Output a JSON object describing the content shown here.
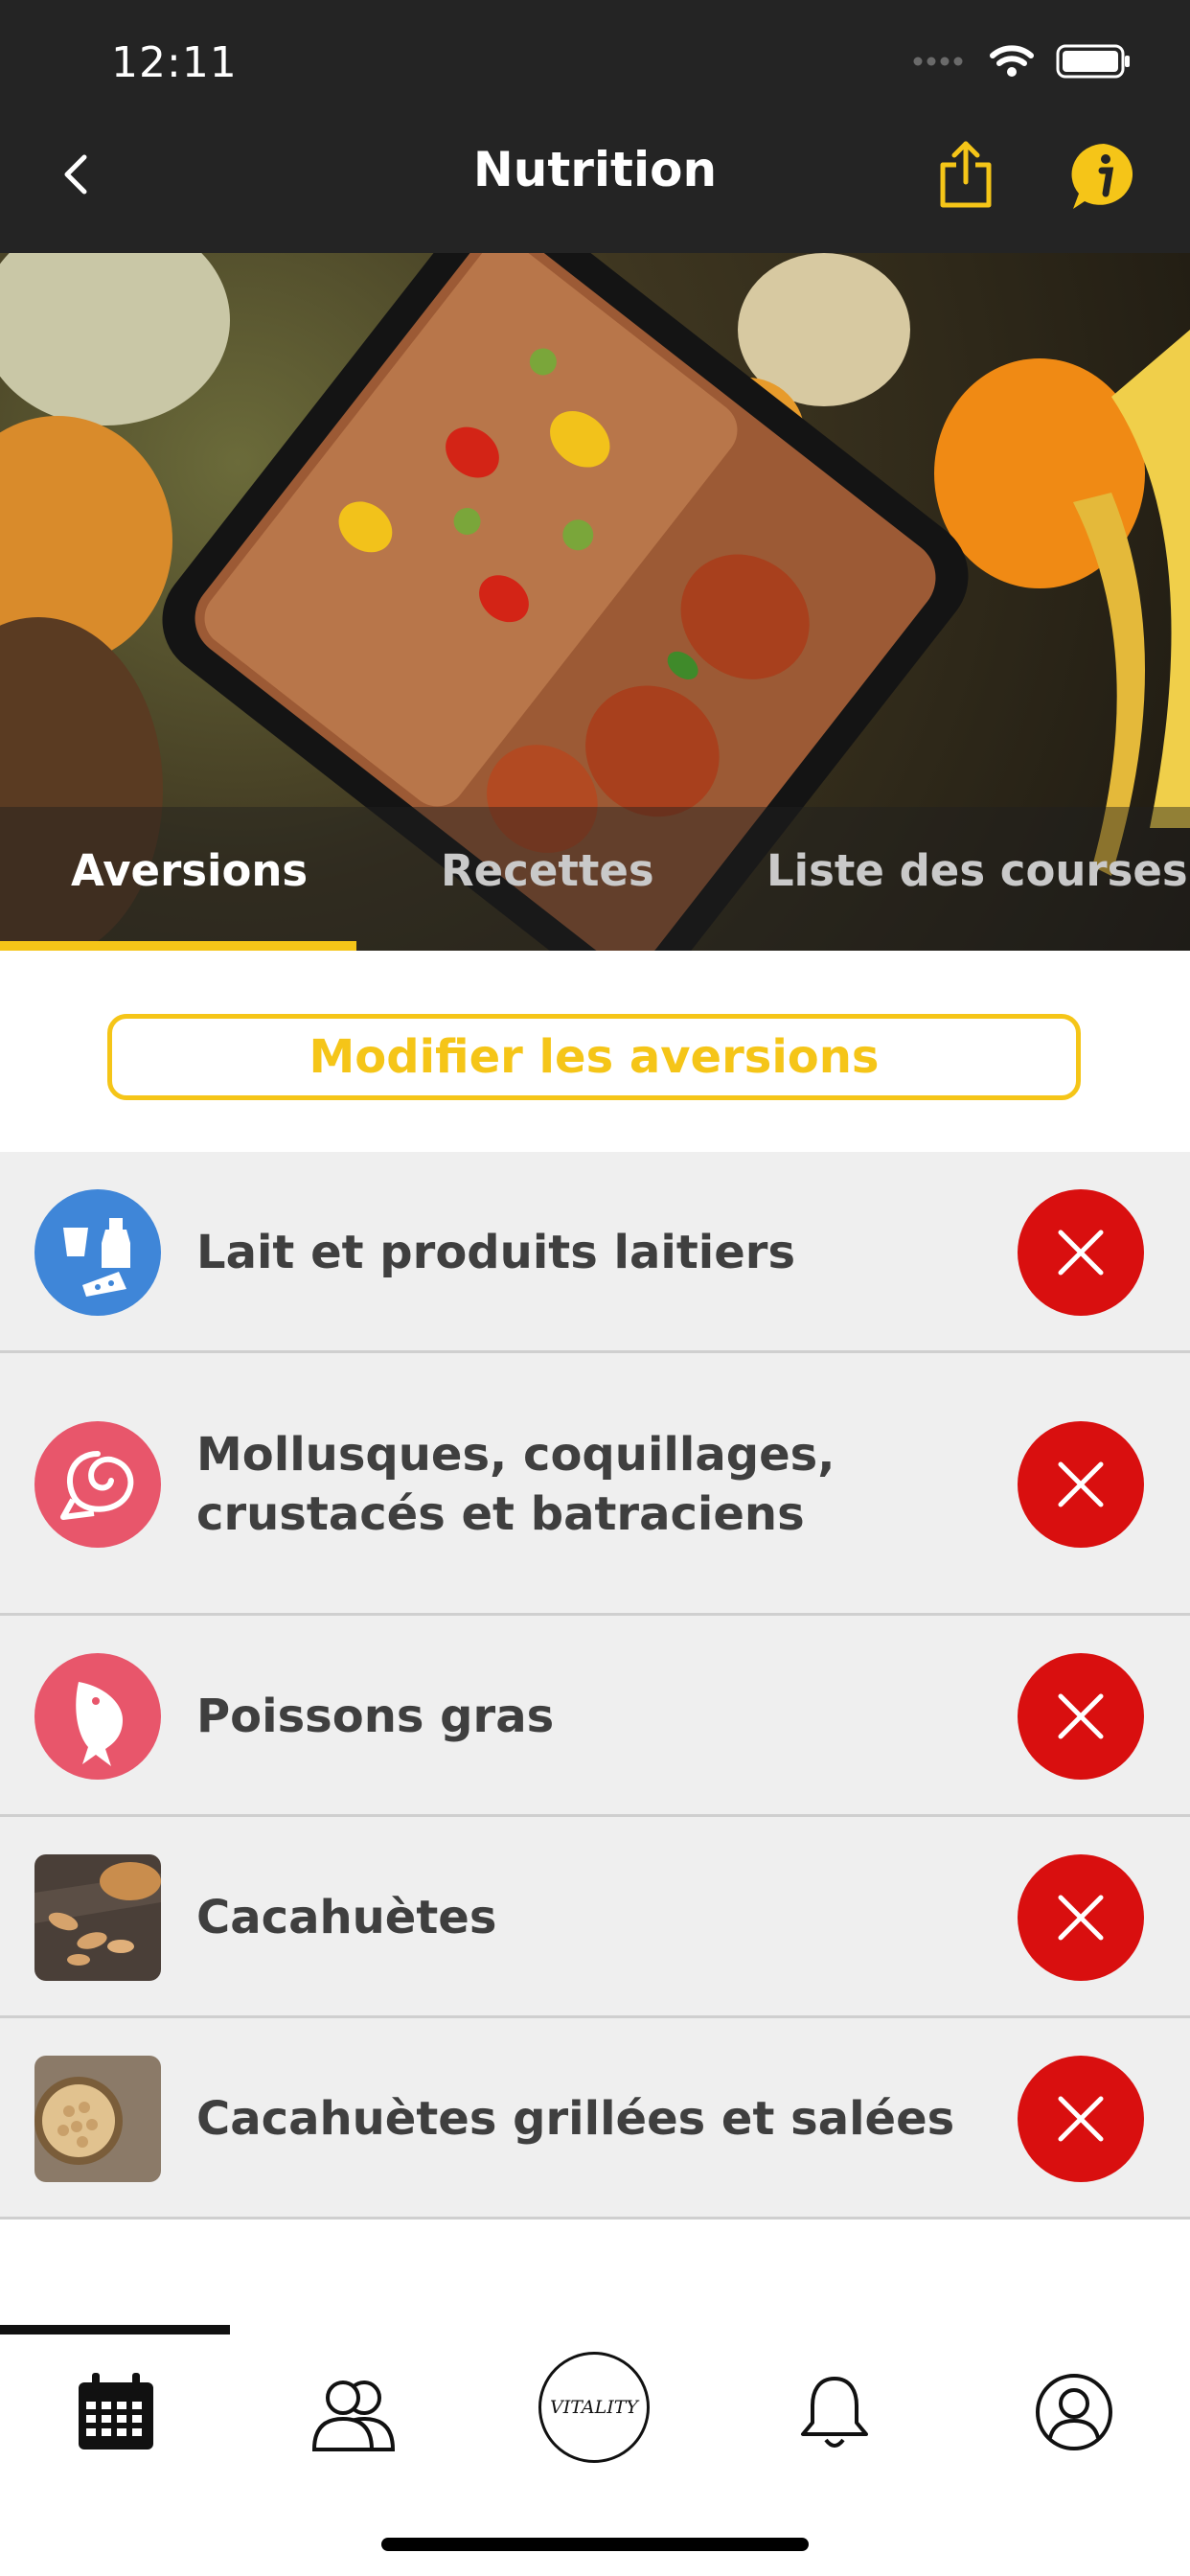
{
  "status_bar": {
    "time": "12:11"
  },
  "header": {
    "title": "Nutrition"
  },
  "tabs": [
    {
      "label": "Aversions",
      "active": true
    },
    {
      "label": "Recettes",
      "active": false
    },
    {
      "label": "Liste des courses",
      "active": false
    }
  ],
  "edit_button": {
    "label": "Modifier les aversions"
  },
  "aversions": [
    {
      "label_lines": [
        "Lait et produits laitiers"
      ],
      "icon": "dairy-icon",
      "icon_color": "#3f86d8"
    },
    {
      "label_lines": [
        "Mollusques, coquillages,",
        "crustacés et batraciens"
      ],
      "icon": "shell-icon",
      "icon_color": "#e8566b"
    },
    {
      "label_lines": [
        "Poissons gras"
      ],
      "icon": "fish-icon",
      "icon_color": "#e8566b"
    },
    {
      "label_lines": [
        "Cacahuètes"
      ],
      "icon": "peanuts-photo"
    },
    {
      "label_lines": [
        "Cacahuètes grillées et salées"
      ],
      "icon": "roasted-peanuts-photo"
    }
  ],
  "colors": {
    "accent": "#f5c518",
    "remove": "#d90f0f",
    "header_bg": "#242424",
    "row_bg": "#efefef"
  },
  "nav": {
    "logo_text": "VITALITY",
    "items": [
      "calendar-icon",
      "group-icon",
      "vitality-logo",
      "bell-icon",
      "profile-icon"
    ]
  }
}
